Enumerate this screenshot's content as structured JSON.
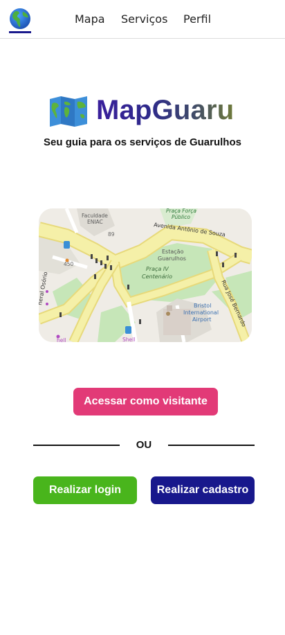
{
  "nav": {
    "logo_icon": "globe-americas-icon",
    "links": [
      "Mapa",
      "Serviços",
      "Perfil"
    ]
  },
  "brand": {
    "icon": "folded-world-map-icon",
    "name": "MapGuaru",
    "tagline": "Seu guia para os serviços de Guarulhos"
  },
  "map": {
    "labels": {
      "faculdade": "Faculdade",
      "eniac": "ENIAC",
      "n89": "89",
      "n450": "450",
      "praca_forca": "Praça Força",
      "publico": "Público",
      "avenida": "Avenida Antônio de Souza",
      "estacao": "Estação",
      "guarulhos": "Guarulhos",
      "praca_iv": "Praça IV",
      "centenario": "Centenário",
      "bristol": "Bristol",
      "international": "International",
      "airport": "Airport",
      "rua_jose": "Rua José Bernardo",
      "osorio": "neral Osório",
      "shell1": "hell",
      "shell2": "Shell"
    }
  },
  "actions": {
    "visitor": "Acessar como visitante",
    "or": "OU",
    "login": "Realizar login",
    "signup": "Realizar cadastro"
  },
  "colors": {
    "visitor": "#e23a77",
    "login": "#49b51c",
    "signup": "#18188c",
    "road": "#f5f0a8",
    "park": "#c6e6b8"
  }
}
